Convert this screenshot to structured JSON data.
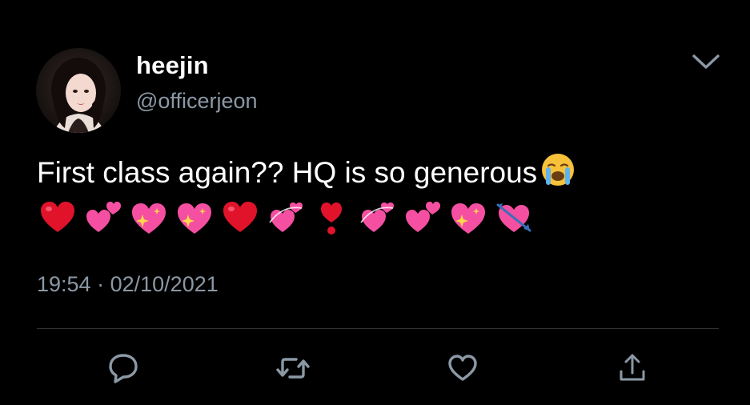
{
  "tweet": {
    "display_name": "heejin",
    "handle": "@officerjeon",
    "text_line1": "First class again?? HQ is so generous",
    "emoji_sequence": [
      "red-heart",
      "two-hearts",
      "sparkling-heart",
      "sparkling-heart",
      "red-heart",
      "revolving-hearts",
      "heart-exclamation",
      "revolving-hearts",
      "two-hearts",
      "sparkling-heart",
      "heart-with-arrow"
    ],
    "trailing_emoji": "loudly-crying-face",
    "time": "19:54",
    "separator": "·",
    "date": "02/10/2021"
  },
  "icons": {
    "more": "chevron-down-icon",
    "reply": "reply-icon",
    "retweet": "retweet-icon",
    "like": "heart-icon",
    "share": "share-icon"
  },
  "colors": {
    "background": "#000000",
    "text": "#ffffff",
    "secondary": "#8b98a5",
    "divider": "#2f3336",
    "heart_red": "#e0132b",
    "heart_pink": "#f54fa2"
  }
}
